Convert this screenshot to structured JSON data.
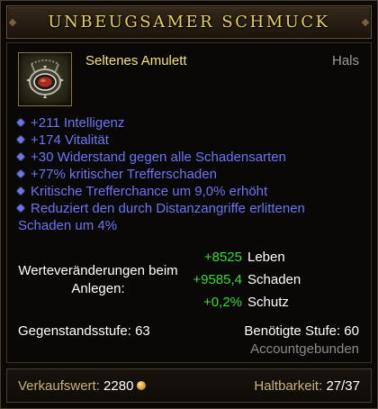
{
  "item": {
    "name": "UNBEUGSAMER SCHMUCK",
    "type": "Seltenes Amulett",
    "slot": "Hals",
    "icon": "amulet-icon"
  },
  "affixes": [
    "+211 Intelligenz",
    "+174 Vitalität",
    "+30 Widerstand gegen alle Schadensarten",
    "+77% kritischer Trefferschaden",
    "Kritische Trefferchance um 9,0% erhöht",
    "Reduziert den durch Distanzangriffe erlittenen Schaden um 4%"
  ],
  "stat_changes": {
    "label": "Werteveränderungen beim Anlegen:",
    "rows": [
      {
        "delta": "+8525",
        "name": "Leben"
      },
      {
        "delta": "+9585,4",
        "name": "Schaden"
      },
      {
        "delta": "+0,2%",
        "name": "Schutz"
      }
    ]
  },
  "item_level": "Gegenstandsstufe: 63",
  "required_level": "Benötigte Stufe: 60",
  "binding": "Accountgebunden",
  "footer": {
    "sell_label": "Verkaufswert:",
    "sell_value": "2280",
    "durability_label": "Haltbarkeit:",
    "durability_value": "27/37"
  },
  "colors": {
    "title": "#e8d05a",
    "rare": "#f2e37a",
    "affix": "#6c74f4",
    "positive": "#33dd33",
    "muted": "#8a8a8a"
  }
}
